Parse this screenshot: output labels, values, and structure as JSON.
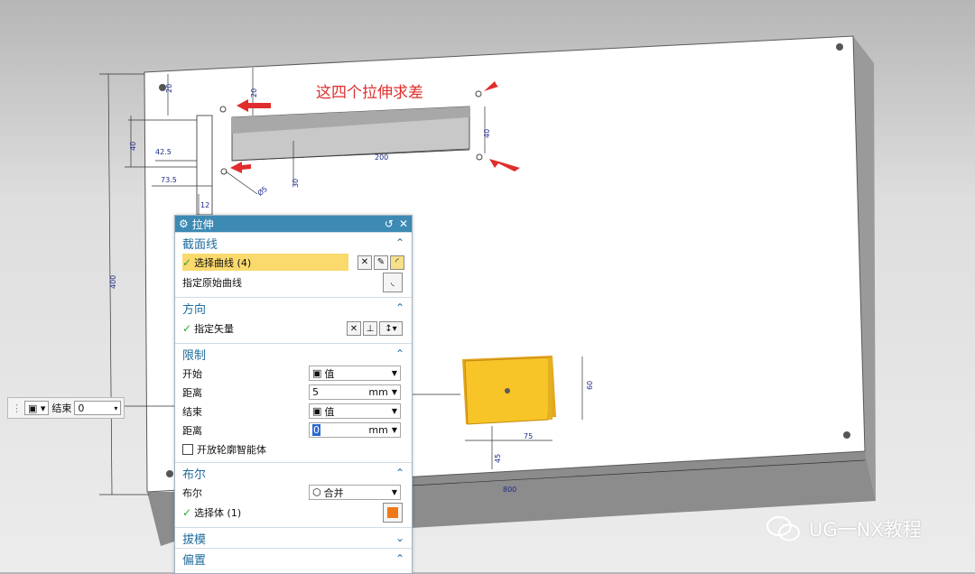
{
  "annotation": "这四个拉伸求差",
  "dimensions": {
    "d_20a": "20",
    "d_20b": "20",
    "d_40a": "40",
    "d_40b": "40",
    "d_200": "200",
    "d_42_5": "42.5",
    "d_73_5": "73.5",
    "d_30": "30",
    "d_12": "12",
    "d_dia5": "Ø5",
    "d_400": "400",
    "d_800": "800",
    "d_75": "75",
    "d_60": "60",
    "d_45": "45"
  },
  "dialog": {
    "title": "拉伸",
    "section_curve": {
      "title": "截面线",
      "select_label": "选择曲线 (4)",
      "origin_label": "指定原始曲线"
    },
    "section_dir": {
      "title": "方向",
      "vector_label": "指定矢量"
    },
    "section_limit": {
      "title": "限制",
      "start_label": "开始",
      "start_value": "值",
      "dist1_label": "距离",
      "dist1_value": "5",
      "dist1_unit": "mm",
      "end_label": "结束",
      "end_value": "值",
      "dist2_label": "距离",
      "dist2_value": "0",
      "dist2_unit": "mm",
      "open_label": "开放轮廓智能体"
    },
    "section_bool": {
      "title": "布尔",
      "bool_label": "布尔",
      "bool_value": "合并",
      "body_label": "选择体 (1)"
    },
    "section_draft": {
      "title": "拔模"
    },
    "section_offset": {
      "title": "偏置"
    }
  },
  "mini_toolbar": {
    "label": "结束",
    "value": "0"
  },
  "watermark": "UG一NX教程",
  "colors": {
    "accent": "#3d8ab4",
    "highlight": "#fad96d",
    "annotation": "#e02d2d",
    "dimension": "#1d2a8a",
    "cube": "#f7c527"
  }
}
